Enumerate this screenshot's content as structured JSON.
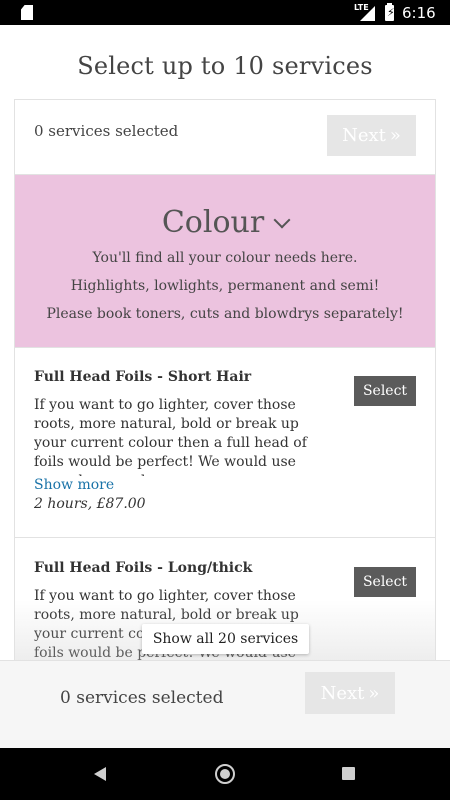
{
  "status_bar": {
    "network": "LTE",
    "time": "6:16"
  },
  "header": {
    "title": "Select up to 10 services"
  },
  "top_bar": {
    "count": "0 services selected",
    "next_label": "Next"
  },
  "category": {
    "title": "Colour",
    "lines": [
      "You'll find all your colour needs here.",
      "Highlights, lowlights, permanent and semi!",
      "Please book toners, cuts and blowdrys separately!"
    ],
    "background": "#ecc3df"
  },
  "services": [
    {
      "name": "Full Head Foils - Short Hair",
      "description": "If you want to go lighter, cover those roots, more natural, bold or break up your current colour then a full head of foils would be perfect! We would use your chosen colours",
      "show_more": "Show more",
      "meta": "2 hours, £87.00",
      "select_label": "Select"
    },
    {
      "name": "Full Head Foils - Long/thick",
      "description": "If you want to go lighter, cover those roots, more natural, bold or break up your current colour then a full head of foils would be perfect! We would use your chosen colours",
      "select_label": "Select"
    }
  ],
  "show_all_label": "Show all 20 services",
  "bottom_bar": {
    "count": "0 services selected",
    "next_label": "Next"
  },
  "colors": {
    "select_button": "#5b5b5b",
    "next_disabled": "#e6e6e6",
    "link": "#1a73a8"
  }
}
